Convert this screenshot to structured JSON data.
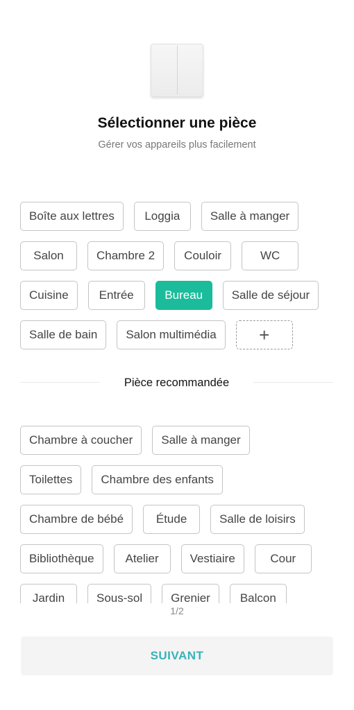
{
  "header": {
    "title": "Sélectionner une pièce",
    "subtitle": "Gérer vos appareils plus facilement",
    "device_icon": "two-gang-wall-switch"
  },
  "rooms": [
    [
      "Boîte aux lettres",
      "Loggia",
      "Salle à manger"
    ],
    [
      "Salon",
      "Chambre 2",
      "Couloir",
      "WC"
    ],
    [
      "Cuisine",
      "Entrée",
      "Bureau",
      "Salle de séjour"
    ],
    [
      "Salle de bain",
      "Salon multimédia"
    ]
  ],
  "selected_room": "Bureau",
  "add_room_symbol": "+",
  "recommended": {
    "label": "Pièce recommandée",
    "rooms": [
      [
        "Chambre à coucher",
        "Salle à manger"
      ],
      [
        "Toilettes",
        "Chambre des enfants"
      ],
      [
        "Chambre de bébé",
        "Étude",
        "Salle de loisirs"
      ],
      [
        "Bibliothèque",
        "Atelier",
        "Vestiaire",
        "Cour"
      ],
      [
        "Jardin",
        "Sous-sol",
        "Grenier",
        "Balcon"
      ]
    ]
  },
  "pagination": {
    "indicator": "1/2"
  },
  "footer": {
    "next_label": "SUIVANT"
  },
  "colors": {
    "accent": "#1bbc9b",
    "next_text": "#38b2b8"
  }
}
